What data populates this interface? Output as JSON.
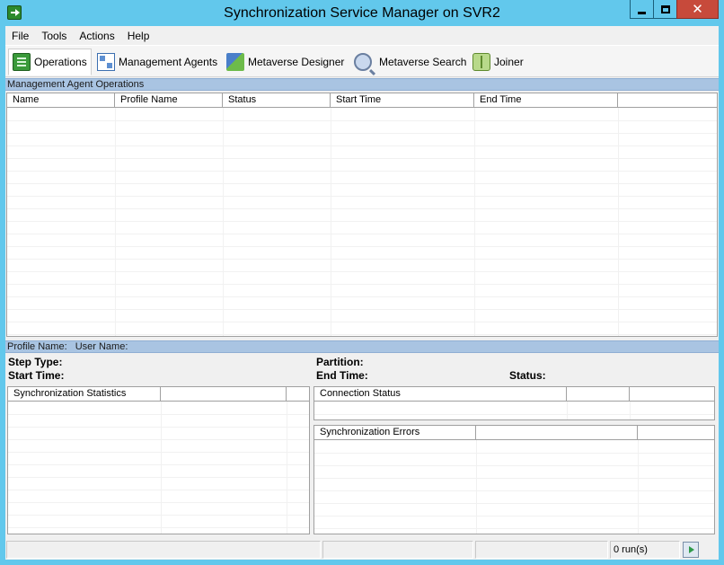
{
  "window": {
    "title": "Synchronization Service Manager on SVR2",
    "close_glyph": "✕"
  },
  "menu": [
    "File",
    "Tools",
    "Actions",
    "Help"
  ],
  "toolbar": {
    "items": [
      {
        "label": "Operations",
        "icon": "operations-icon",
        "active": true
      },
      {
        "label": "Management Agents",
        "icon": "management-agents-icon"
      },
      {
        "label": "Metaverse Designer",
        "icon": "metaverse-designer-icon"
      },
      {
        "label": "Metaverse Search",
        "icon": "metaverse-search-icon"
      },
      {
        "label": "Joiner",
        "icon": "joiner-icon"
      }
    ]
  },
  "operations": {
    "section_title": "Management Agent Operations",
    "columns": [
      "Name",
      "Profile Name",
      "Status",
      "Start Time",
      "End Time",
      ""
    ],
    "rows": []
  },
  "detail": {
    "header_profile": "Profile Name:",
    "header_user": "User Name:",
    "step_type": "Step Type:",
    "start_time": "Start Time:",
    "partition": "Partition:",
    "end_time": "End Time:",
    "status": "Status:"
  },
  "sync_stats": {
    "columns": [
      "Synchronization Statistics",
      "",
      ""
    ]
  },
  "connection_status": {
    "columns": [
      "Connection Status",
      "",
      ""
    ]
  },
  "sync_errors": {
    "columns": [
      "Synchronization Errors",
      "",
      ""
    ]
  },
  "statusbar": {
    "panels": [
      "",
      "",
      "",
      "0 run(s)"
    ]
  },
  "colors": {
    "titlebar": "#62c8ec",
    "section_bar": "#a9c4e2",
    "close_button": "#c74a3b"
  }
}
